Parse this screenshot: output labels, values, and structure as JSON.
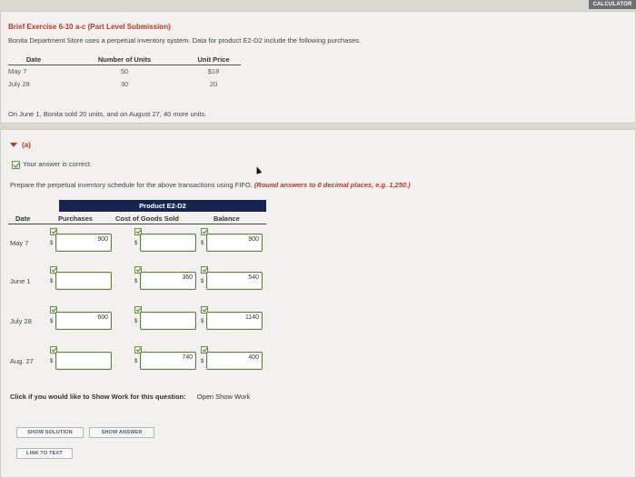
{
  "calculator_label": "CALCULATOR",
  "exercise": {
    "title": "Brief Exercise 6-10 a-c (Part Level Submission)",
    "description": "Bonita Department Store uses a perpetual inventory system. Data for product E2-D2 include the following purchases.",
    "purchases_headers": [
      "Date",
      "Number of Units",
      "Unit Price"
    ],
    "purchases": [
      {
        "date": "May 7",
        "units": "50",
        "price": "$18"
      },
      {
        "date": "July 28",
        "units": "30",
        "price": "20"
      }
    ],
    "sales_note": "On June 1, Bonita sold 20 units, and on August 27, 40 more units."
  },
  "part": {
    "label": "(a)",
    "correct_msg": "Your answer is correct.",
    "instruction_plain": "Prepare the perpetual inventory schedule for the above transactions using FIFO.",
    "instruction_note": "(Round answers to 0 decimal places, e.g. 1,250.)",
    "schedule": {
      "product_title": "Product E2-D2",
      "headers": [
        "Date",
        "Purchases",
        "Cost of Goods Sold",
        "Balance"
      ],
      "dollar_sign": "$",
      "rows": [
        {
          "date": "May 7",
          "purchases": "900",
          "cogs": "",
          "balance": "900"
        },
        {
          "date": "June 1",
          "purchases": "",
          "cogs": "360",
          "balance": "540"
        },
        {
          "date": "July 28",
          "purchases": "600",
          "cogs": "",
          "balance": "1140"
        },
        {
          "date": "Aug. 27",
          "purchases": "",
          "cogs": "740",
          "balance": "400"
        }
      ]
    },
    "show_work_prompt": "Click if you would like to Show Work for this question:",
    "show_work_link": "Open Show Work"
  },
  "buttons": {
    "show_solution": "SHOW SOLUTION",
    "show_answer": "SHOW ANSWER",
    "link_to_text": "LINK TO TEXT"
  }
}
